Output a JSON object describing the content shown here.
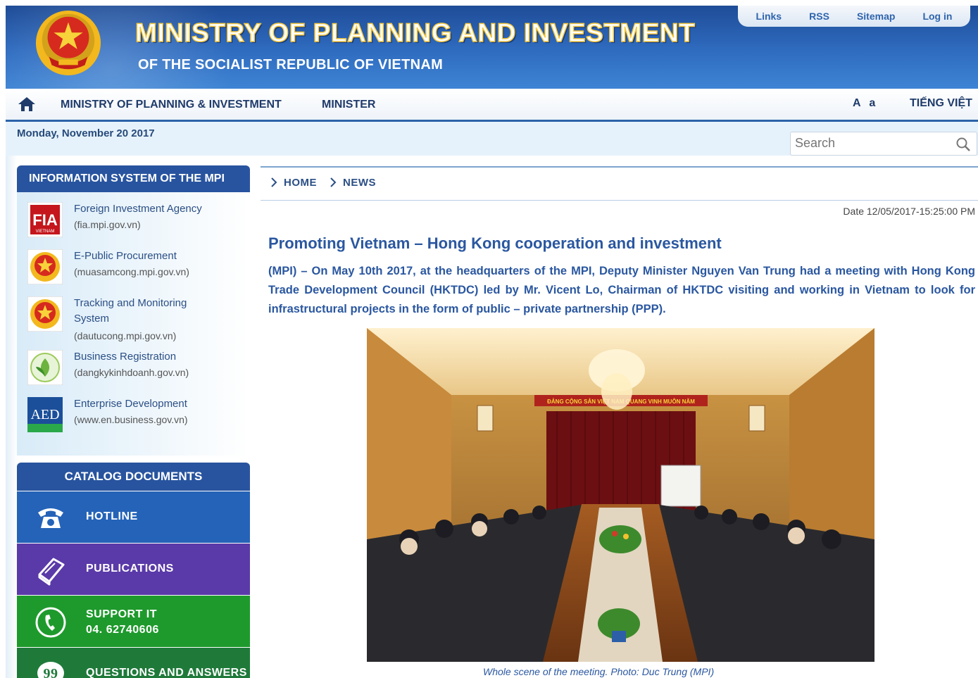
{
  "header": {
    "title": "MINISTRY OF PLANNING AND INVESTMENT",
    "subtitle": "OF THE SOCIALIST REPUBLIC OF VIETNAM",
    "links": [
      "Links",
      "RSS",
      "Sitemap",
      "Log in"
    ]
  },
  "nav": {
    "items": [
      "MINISTRY OF PLANNING & INVESTMENT",
      "MINISTER"
    ],
    "font_size": "A a",
    "language": "TIẾNG VIỆT"
  },
  "datebar": {
    "date": "Monday, November 20 2017",
    "search_placeholder": "Search"
  },
  "sidebar": {
    "info_heading": "INFORMATION SYSTEM OF THE MPI",
    "info_items": [
      {
        "title": "Foreign Investment Agency",
        "url": "(fia.mpi.gov.vn)",
        "logo": "FIA"
      },
      {
        "title": "E-Public Procurement",
        "url": "(muasamcong.mpi.gov.vn)",
        "logo": "emblem"
      },
      {
        "title": "Tracking and Monitoring System",
        "url": "(dautucong.mpi.gov.vn)",
        "logo": "emblem"
      },
      {
        "title": "Business Registration",
        "url": "(dangkykinhdoanh.gov.vn)",
        "logo": "leaf"
      },
      {
        "title": "Enterprise Development",
        "url": "(www.en.business.gov.vn)",
        "logo": "AED"
      }
    ],
    "catalog_heading": "CATALOG DOCUMENTS",
    "catalog_items": [
      {
        "label": "HOTLINE",
        "icon": "telephone-icon",
        "color": "#2563b8"
      },
      {
        "label": "PUBLICATIONS",
        "icon": "book-icon",
        "color": "#5a3aa8"
      },
      {
        "label": "SUPPORT IT",
        "label2": "04. 62740606",
        "icon": "phone-handset-icon",
        "color": "#1e9a2c"
      },
      {
        "label": "QUESTIONS AND ANSWERS",
        "icon": "speech-bubble-icon",
        "color": "#1f7a3a"
      }
    ]
  },
  "breadcrumb": [
    "HOME",
    "NEWS"
  ],
  "article": {
    "date": "Date 12/05/2017-15:25:00 PM",
    "headline": "Promoting Vietnam – Hong Kong cooperation and investment",
    "lead": "(MPI) – On May 10th 2017, at the headquarters of the MPI, Deputy Minister Nguyen Van Trung had a meeting with Hong Kong Trade Development Council (HKTDC) led by Mr. Vicent Lo, Chairman of HKTDC visiting and working in Vietnam to look for infrastructural projects in the form of public – private partnership (PPP).",
    "banner_text": "ĐẢNG CỘNG SẢN VIỆT NAM QUANG VINH MUÔN NĂM",
    "caption": "Whole scene of the meeting. Photo: Duc Trung (MPI)"
  },
  "colors": {
    "header_blue": "#2f6cc0",
    "heading_blue": "#28549f",
    "text_blue": "#2a57a0",
    "hotline": "#2563b8",
    "publications": "#5a3aa8",
    "support": "#1e9a2c",
    "qa": "#1f7a3a"
  }
}
